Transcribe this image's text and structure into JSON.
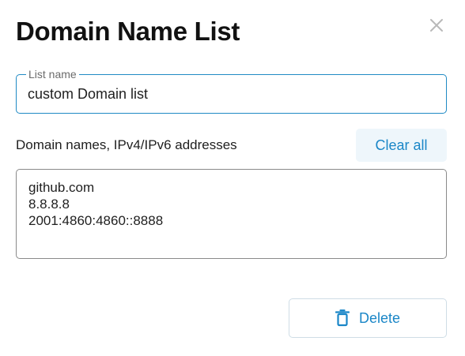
{
  "dialog": {
    "title": "Domain Name List",
    "close_icon": "close-icon"
  },
  "list_name": {
    "legend": "List name",
    "value": "custom Domain list"
  },
  "domains": {
    "label": "Domain names, IPv4/IPv6 addresses",
    "clear_all_label": "Clear all",
    "entries": "github.com\n8.8.8.8\n2001:4860:4860::8888"
  },
  "actions": {
    "delete_label": "Delete",
    "delete_icon": "trash-icon"
  },
  "colors": {
    "accent": "#1a86c7",
    "input_border_focused": "#1f8ac4",
    "clear_button_bg": "#eef6fb"
  }
}
